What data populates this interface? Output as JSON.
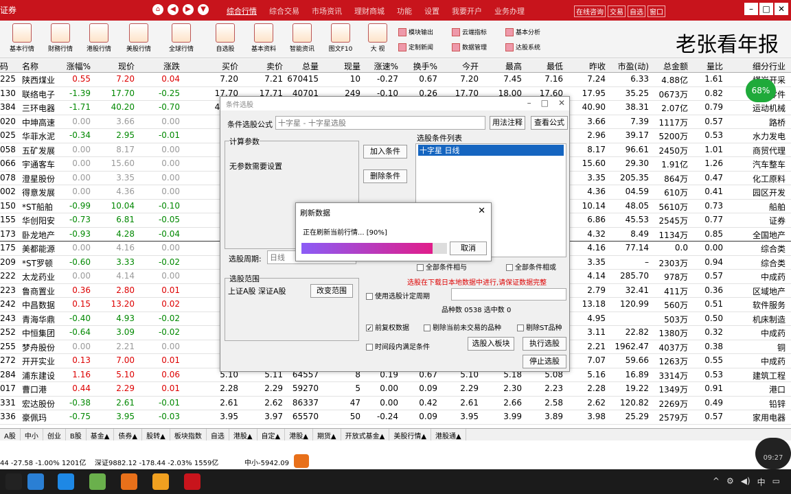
{
  "app": {
    "logo": "证券",
    "nav_home": "⌂",
    "nav_back": "◀",
    "nav_fwd": "▶",
    "nav_down": "▼",
    "menu": [
      "综合行情",
      "综合交易",
      "市场资讯",
      "理财商城",
      "功能",
      "设置",
      "我要开户",
      "业务办理"
    ],
    "menu2": [
      "在线咨询",
      "交易",
      "自选",
      "窗口"
    ],
    "watermark": "老张看年报"
  },
  "toolbar": {
    "big": [
      "基本行情",
      "財務行情",
      "港股行情",
      "美股行情",
      "全球行情",
      "自选股",
      "基本资料",
      "智能资讯",
      "图文F10",
      "大 视"
    ],
    "small": [
      [
        "模块输出",
        "定制新闻"
      ],
      [
        "云端指标",
        "数据管理"
      ],
      [
        "基本分析",
        "达股系统"
      ]
    ]
  },
  "table": {
    "headers": [
      "码",
      "名称",
      "涨幅%",
      "现价",
      "涨跌",
      "买价",
      "卖价",
      "总量",
      "现量",
      "涨速%",
      "换手%",
      "今开",
      "最高",
      "最低",
      "昨收",
      "市盈(动)",
      "总金额",
      "量比",
      "细分行业"
    ],
    "rows": [
      [
        "225",
        "陕西煤业",
        "0.55",
        "7.20",
        "0.04",
        "7.20",
        "7.21",
        "670415",
        "10",
        "-0.27",
        "0.67",
        "7.20",
        "7.45",
        "7.16",
        "7.24",
        "6.33",
        "4.88亿",
        "1.61",
        "煤炭开采"
      ],
      [
        "130",
        "联络电子",
        "-1.39",
        "17.70",
        "-0.25",
        "17.70",
        "17.71",
        "40701",
        "249",
        "-0.10",
        "0.26",
        "17.70",
        "18.00",
        "17.60",
        "17.95",
        "35.25",
        "0673万",
        "0.82",
        "电子零件"
      ],
      [
        "384",
        "三环电器",
        "-1.71",
        "40.20",
        "-0.70",
        "40.20",
        "40.21",
        "19800",
        "12",
        "0.00",
        "0.30",
        "40.90",
        "41.00",
        "40.10",
        "40.90",
        "38.31",
        "2.07亿",
        "0.79",
        "运动机械"
      ],
      [
        "020",
        "中坤高速",
        "0.00",
        "3.66",
        "0.00",
        "",
        "",
        "",
        "",
        "",
        "",
        "",
        "",
        "",
        "3.66",
        "7.39",
        "1117万",
        "0.57",
        "路桥"
      ],
      [
        "025",
        "华菲水泥",
        "-0.34",
        "2.95",
        "-0.01",
        "",
        "",
        "",
        "",
        "",
        "",
        "",
        "",
        "",
        "2.96",
        "39.17",
        "5200万",
        "0.53",
        "水力发电"
      ],
      [
        "058",
        "五矿发展",
        "0.00",
        "8.17",
        "0.00",
        "",
        "",
        "",
        "",
        "",
        "",
        "",
        "",
        "",
        "8.17",
        "96.61",
        "2450万",
        "1.01",
        "商贸代理"
      ],
      [
        "066",
        "宇通客车",
        "0.00",
        "15.60",
        "0.00",
        "",
        "",
        "",
        "",
        "",
        "",
        "",
        "",
        "",
        "15.60",
        "29.30",
        "1.91亿",
        "1.26",
        "汽车整车"
      ],
      [
        "078",
        "澄星股份",
        "0.00",
        "3.35",
        "0.00",
        "",
        "",
        "",
        "",
        "",
        "",
        "",
        "",
        "",
        "3.35",
        "205.35",
        "864万",
        "0.47",
        "化工原料"
      ],
      [
        "002",
        "得意发展",
        "0.00",
        "4.36",
        "0.00",
        "",
        "",
        "",
        "",
        "",
        "",
        "",
        "",
        "",
        "4.36",
        "04.59",
        "610万",
        "0.41",
        "园区开发"
      ],
      [
        "150",
        "*ST船舶",
        "-0.99",
        "10.04",
        "-0.10",
        "",
        "",
        "",
        "",
        "",
        "",
        "",
        "",
        "",
        "10.14",
        "48.05",
        "5610万",
        "0.73",
        "船舶"
      ],
      [
        "155",
        "华创阳安",
        "-0.73",
        "6.81",
        "-0.05",
        "",
        "",
        "",
        "",
        "",
        "",
        "",
        "",
        "",
        "6.86",
        "45.53",
        "2545万",
        "0.77",
        "证券"
      ],
      [
        "173",
        "卧龙地产",
        "-0.93",
        "4.28",
        "-0.04",
        "",
        "",
        "",
        "",
        "",
        "",
        "",
        "",
        "",
        "4.32",
        "8.49",
        "1134万",
        "0.85",
        "全国地产"
      ],
      [
        "175",
        "美都能源",
        "0.00",
        "4.16",
        "0.00",
        "",
        "",
        "",
        "",
        "",
        "",
        "",
        "",
        "",
        "4.16",
        "77.14",
        "0.0",
        "0.00",
        "综合类"
      ],
      [
        "209",
        "*ST罗顿",
        "-0.60",
        "3.33",
        "-0.02",
        "",
        "",
        "",
        "",
        "",
        "",
        "",
        "",
        "",
        "3.35",
        "–",
        "2303万",
        "0.94",
        "综合类"
      ],
      [
        "222",
        "太龙药业",
        "0.00",
        "4.14",
        "0.00",
        "",
        "",
        "",
        "",
        "",
        "",
        "",
        "",
        "",
        "4.14",
        "285.70",
        "978万",
        "0.57",
        "中成药"
      ],
      [
        "223",
        "鲁商置业",
        "0.36",
        "2.80",
        "0.01",
        "",
        "",
        "",
        "",
        "",
        "",
        "",
        "",
        "",
        "2.79",
        "32.41",
        "411万",
        "0.36",
        "区域地产"
      ],
      [
        "242",
        "中昌数据",
        "0.15",
        "13.20",
        "0.02",
        "",
        "",
        "",
        "",
        "",
        "",
        "",
        "",
        "",
        "13.18",
        "120.99",
        "560万",
        "0.51",
        "软件服务"
      ],
      [
        "243",
        "青海华鼎",
        "-0.40",
        "4.93",
        "-0.02",
        "",
        "",
        "",
        "",
        "",
        "",
        "",
        "",
        "",
        "4.95",
        "",
        "503万",
        "0.50",
        "机床制造"
      ],
      [
        "252",
        "中恒集团",
        "-0.64",
        "3.09",
        "-0.02",
        "",
        "",
        "",
        "",
        "",
        "",
        "",
        "",
        "",
        "3.11",
        "22.82",
        "1380万",
        "0.32",
        "中成药"
      ],
      [
        "255",
        "梦舟股份",
        "0.00",
        "2.21",
        "0.00",
        "",
        "",
        "",
        "",
        "",
        "",
        "",
        "",
        "",
        "2.21",
        "1962.47",
        "4037万",
        "0.38",
        "铜"
      ],
      [
        "272",
        "开开实业",
        "0.13",
        "7.00",
        "0.01",
        "",
        "",
        "",
        "",
        "",
        "",
        "",
        "",
        "",
        "7.07",
        "59.66",
        "1263万",
        "0.55",
        "中成药"
      ],
      [
        "284",
        "浦东建设",
        "1.16",
        "5.10",
        "0.06",
        "5.10",
        "5.11",
        "64557",
        "8",
        "0.19",
        "0.67",
        "5.10",
        "5.18",
        "5.08",
        "5.16",
        "16.89",
        "3314万",
        "0.53",
        "建筑工程"
      ],
      [
        "017",
        "曹口港",
        "0.44",
        "2.29",
        "0.01",
        "2.28",
        "2.29",
        "59270",
        "5",
        "0.00",
        "0.09",
        "2.29",
        "2.30",
        "2.23",
        "2.28",
        "19.22",
        "1349万",
        "0.91",
        "港口"
      ],
      [
        "331",
        "宏达股份",
        "-0.38",
        "2.61",
        "-0.01",
        "2.61",
        "2.62",
        "86337",
        "47",
        "0.00",
        "0.42",
        "2.61",
        "2.66",
        "2.58",
        "2.62",
        "120.82",
        "2269万",
        "0.49",
        "铅锌"
      ],
      [
        "336",
        "豪佩玛",
        "-0.75",
        "3.95",
        "-0.03",
        "3.95",
        "3.97",
        "65570",
        "50",
        "-0.24",
        "0.09",
        "3.95",
        "3.99",
        "3.89",
        "3.98",
        "25.29",
        "2579万",
        "0.57",
        "家用电器"
      ]
    ]
  },
  "tabs": [
    "A股",
    "中小",
    "创业",
    "B股",
    "基金▲",
    "债券▲",
    "股转▲",
    "板块指数",
    "自选",
    "港股▲",
    "自定▲",
    "港股▲",
    "期货▲",
    "开放式基金▲",
    "美股行情▲",
    "港股通▲"
  ],
  "status": [
    "44 -27.58 -1.00% 1201亿",
    "深证9882.12 -178.44 -2.03% 1559亿",
    "中小-5942.09"
  ],
  "dialog": {
    "title": "条件选股",
    "formula_label": "条件选股公式",
    "formula_value": "十字星  - 十字星选股",
    "use_formula": "用法注释",
    "view_formula": "查看公式",
    "params_label": "计算参数",
    "no_params": "无参数需要设置",
    "add_cond": "加入条件",
    "del_cond": "删除条件",
    "list_label": "选股条件列表",
    "list_item": "十字星  日线",
    "period_label": "选股周期:",
    "period_value": "日线",
    "scope_label": "选股范围",
    "scope_value": "上证A股 深证A股",
    "change_scope": "改变范围",
    "note": "选股在下载日本地数据中进行,请保证数据完整",
    "chk_period": "使用选股计定周期",
    "range": "品种数 0538   选中数 0",
    "chk_prev": "前复权数据",
    "chk_ai": "剔除当前未交易的品种",
    "chk_st": "剔除ST品种",
    "chk_time": "时间段内满足条件",
    "to_block": "选股入板块",
    "exec": "执行选股",
    "stop": "停止选股",
    "and_label": "全部条件相与",
    "or_label": "全部条件相或"
  },
  "progress": {
    "title": "刷新数据",
    "text": "正在刷新当前行情... [90%]",
    "cancel": "取消",
    "fill": 0.9,
    "close": "✕"
  },
  "bubble": "68%",
  "clock": "09:27"
}
